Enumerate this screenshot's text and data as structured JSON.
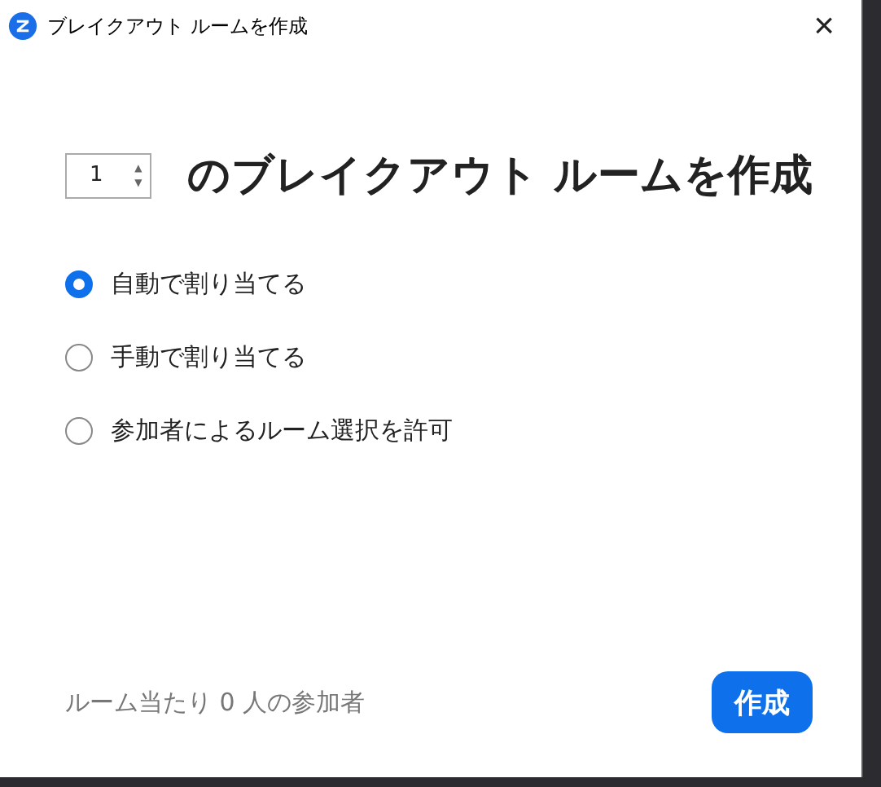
{
  "window": {
    "title": "ブレイクアウト ルームを作成",
    "close": "×"
  },
  "room_count": {
    "value": "1",
    "up": "▲",
    "down": "▼"
  },
  "heading": "のブレイクアウト ルームを作成",
  "options": [
    {
      "label": "自動で割り当てる",
      "selected": true
    },
    {
      "label": "手動で割り当てる",
      "selected": false
    },
    {
      "label": "参加者によるルーム選択を許可",
      "selected": false
    }
  ],
  "footer": {
    "note": "ルーム当たり 0 人の参加者",
    "button": "作成"
  }
}
